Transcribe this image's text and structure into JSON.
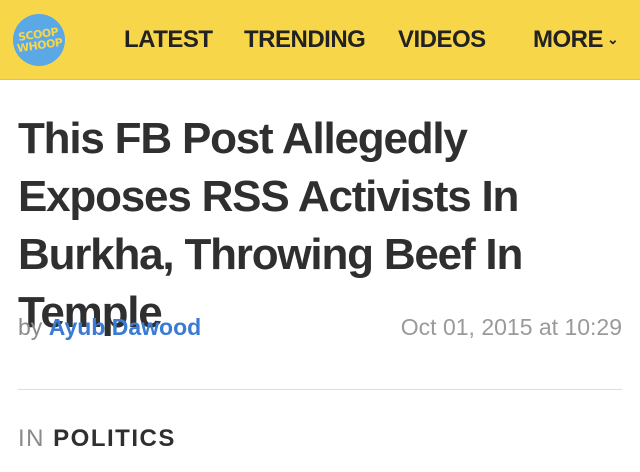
{
  "header": {
    "logo_text": "SCOOP WHOOP",
    "nav": [
      {
        "label": "LATEST"
      },
      {
        "label": "TRENDING"
      },
      {
        "label": "VIDEOS"
      },
      {
        "label": "MORE"
      }
    ],
    "more_icon": "chevron-down-icon"
  },
  "article": {
    "title": "This FB Post Allegedly Exposes RSS Activists In Burkha, Throwing Beef In Temple",
    "by_prefix": "by",
    "author": "Ayub Dawood",
    "date": "Oct 01, 2015 at 10:29",
    "category_prefix": "IN",
    "category": "POLITICS"
  },
  "colors": {
    "header_bg": "#f8d64a",
    "logo_bg": "#5aa8e6",
    "author_link": "#3a7bd5"
  }
}
